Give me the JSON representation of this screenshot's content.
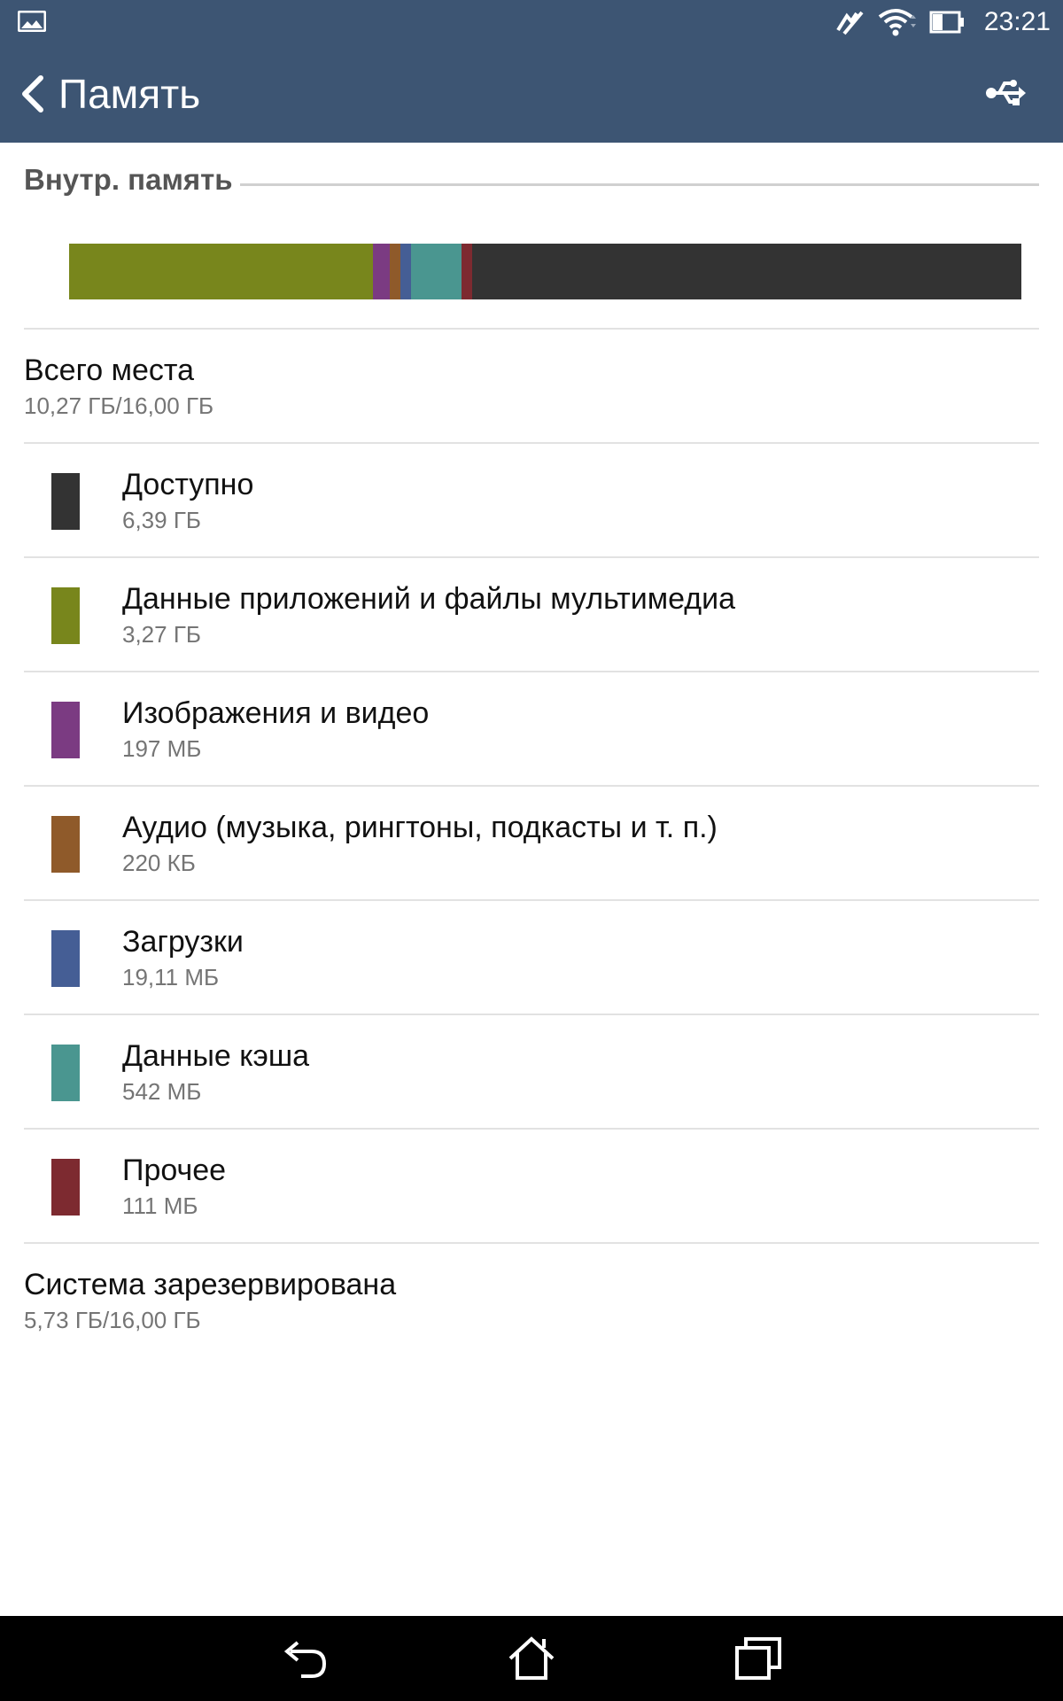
{
  "status_bar": {
    "time": "23:21"
  },
  "app_bar": {
    "title": "Память"
  },
  "section": {
    "title": "Внутр. память"
  },
  "total": {
    "title": "Всего места",
    "value": "10,27 ГБ/16,00 ГБ"
  },
  "categories": [
    {
      "title": "Доступно",
      "value": "6,39 ГБ",
      "color": "#333333"
    },
    {
      "title": "Данные приложений и файлы мультимедиа",
      "value": "3,27 ГБ",
      "color": "#78861c"
    },
    {
      "title": "Изображения и видео",
      "value": "197 МБ",
      "color": "#7b3b82"
    },
    {
      "title": "Аудио (музыка, рингтоны, подкасты и т. п.)",
      "value": "220 КБ",
      "color": "#8f5a2a"
    },
    {
      "title": "Загрузки",
      "value": "19,11 МБ",
      "color": "#455e95"
    },
    {
      "title": "Данные кэша",
      "value": "542 МБ",
      "color": "#4a9690"
    },
    {
      "title": "Прочее",
      "value": "111 МБ",
      "color": "#7d2a30"
    }
  ],
  "storage_bar": {
    "segments": [
      {
        "name": "apps",
        "fraction": 0.319,
        "color": "#78861c"
      },
      {
        "name": "images",
        "fraction": 0.018,
        "color": "#7b3b82"
      },
      {
        "name": "audio",
        "fraction": 0.011,
        "color": "#8f5a2a"
      },
      {
        "name": "downloads",
        "fraction": 0.011,
        "color": "#455e95"
      },
      {
        "name": "cache",
        "fraction": 0.053,
        "color": "#4a9690"
      },
      {
        "name": "other",
        "fraction": 0.011,
        "color": "#7d2a30"
      },
      {
        "name": "available",
        "fraction": 0.577,
        "color": "#333333"
      }
    ]
  },
  "system": {
    "title": "Система зарезервирована",
    "value": "5,73 ГБ/16,00 ГБ"
  }
}
